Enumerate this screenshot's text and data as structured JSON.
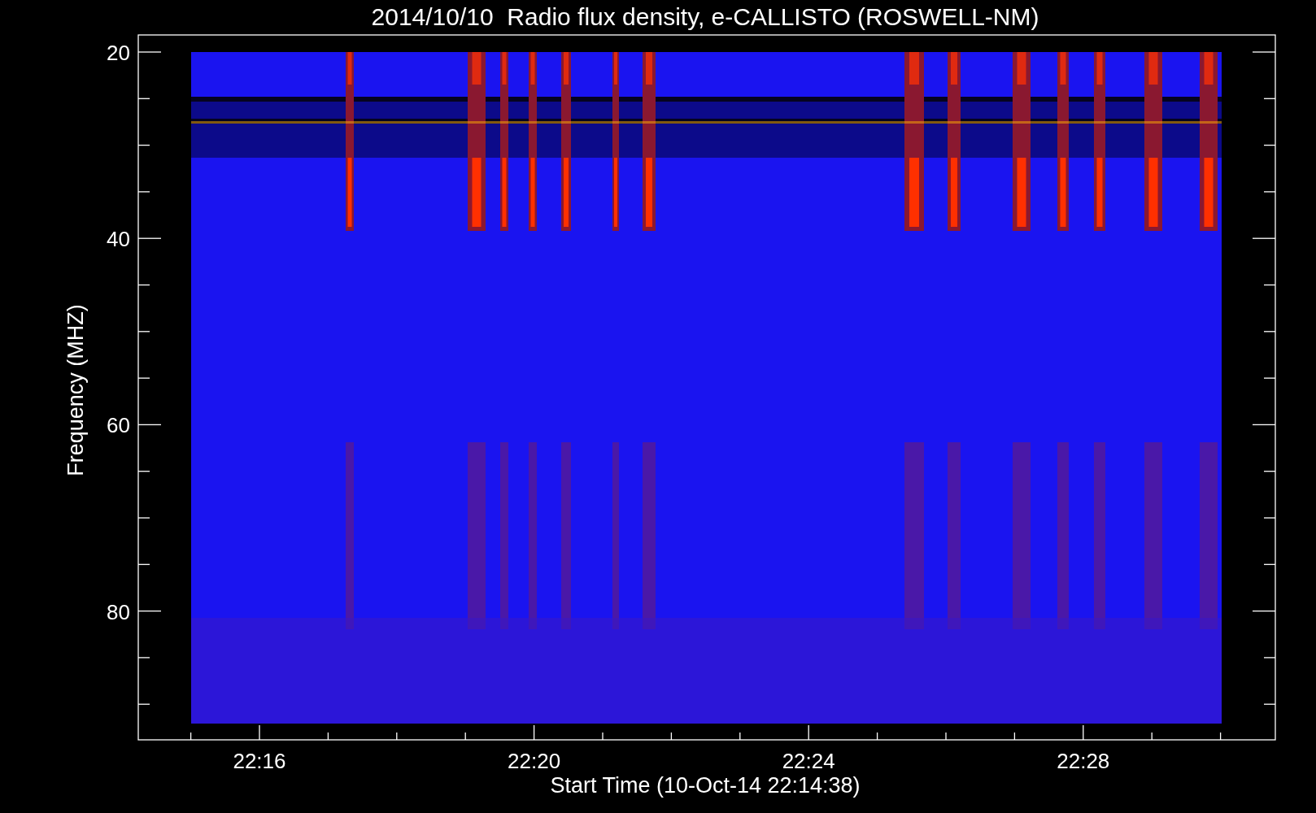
{
  "title": "2014/10/10  Radio flux density, e-CALLISTO (ROSWELL-NM)",
  "y_axis": {
    "label": "Frequency (MHZ)",
    "ticks": [
      "20",
      "40",
      "60",
      "80"
    ]
  },
  "x_axis": {
    "label": "Start Time (10-Oct-14 22:14:38)",
    "ticks": [
      "22:16",
      "22:20",
      "22:24",
      "22:28"
    ]
  }
}
